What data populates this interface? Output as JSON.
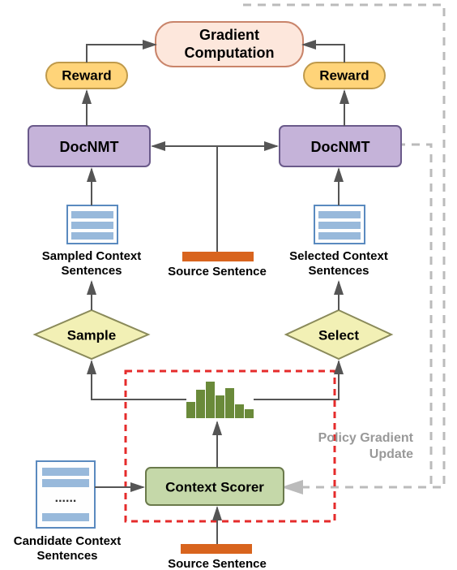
{
  "top": {
    "gradient_line1": "Gradient",
    "gradient_line2": "Computation",
    "reward_left": "Reward",
    "reward_right": "Reward"
  },
  "mid": {
    "docnmt_left": "DocNMT",
    "docnmt_right": "DocNMT",
    "source_sentence": "Source Sentence"
  },
  "docs": {
    "sampled_line1": "Sampled Context",
    "sampled_line2": "Sentences",
    "selected_line1": "Selected Context",
    "selected_line2": "Sentences"
  },
  "diamonds": {
    "sample": "Sample",
    "select": "Select"
  },
  "bottom": {
    "context_scorer": "Context Scorer",
    "source_sentence2": "Source Sentence",
    "candidate_line1": "Candidate Context",
    "candidate_line2": "Sentences",
    "policy_line1": "Policy Gradient",
    "policy_line2": "Update"
  },
  "colors": {
    "peach_fill": "#fde7dc",
    "peach_stroke": "#c9846a",
    "yellow_fill": "#ffd479",
    "yellow_stroke": "#bf9a4b",
    "purple_fill": "#c5b3d9",
    "purple_stroke": "#6a5a8a",
    "orange": "#d8641e",
    "green_box_fill": "#c5d8a9",
    "green_box_stroke": "#6a7a4b",
    "diamond_fill": "#f2f0b5",
    "diamond_stroke": "#8a8a5a",
    "doc_fill": "#fefefe",
    "doc_stroke": "#5a8abf",
    "doc_line": "#98b9db",
    "arrow": "#555",
    "dashed_gray": "#bbb",
    "dashed_red": "#e52b2b",
    "barchart": "#6a8a3a"
  }
}
